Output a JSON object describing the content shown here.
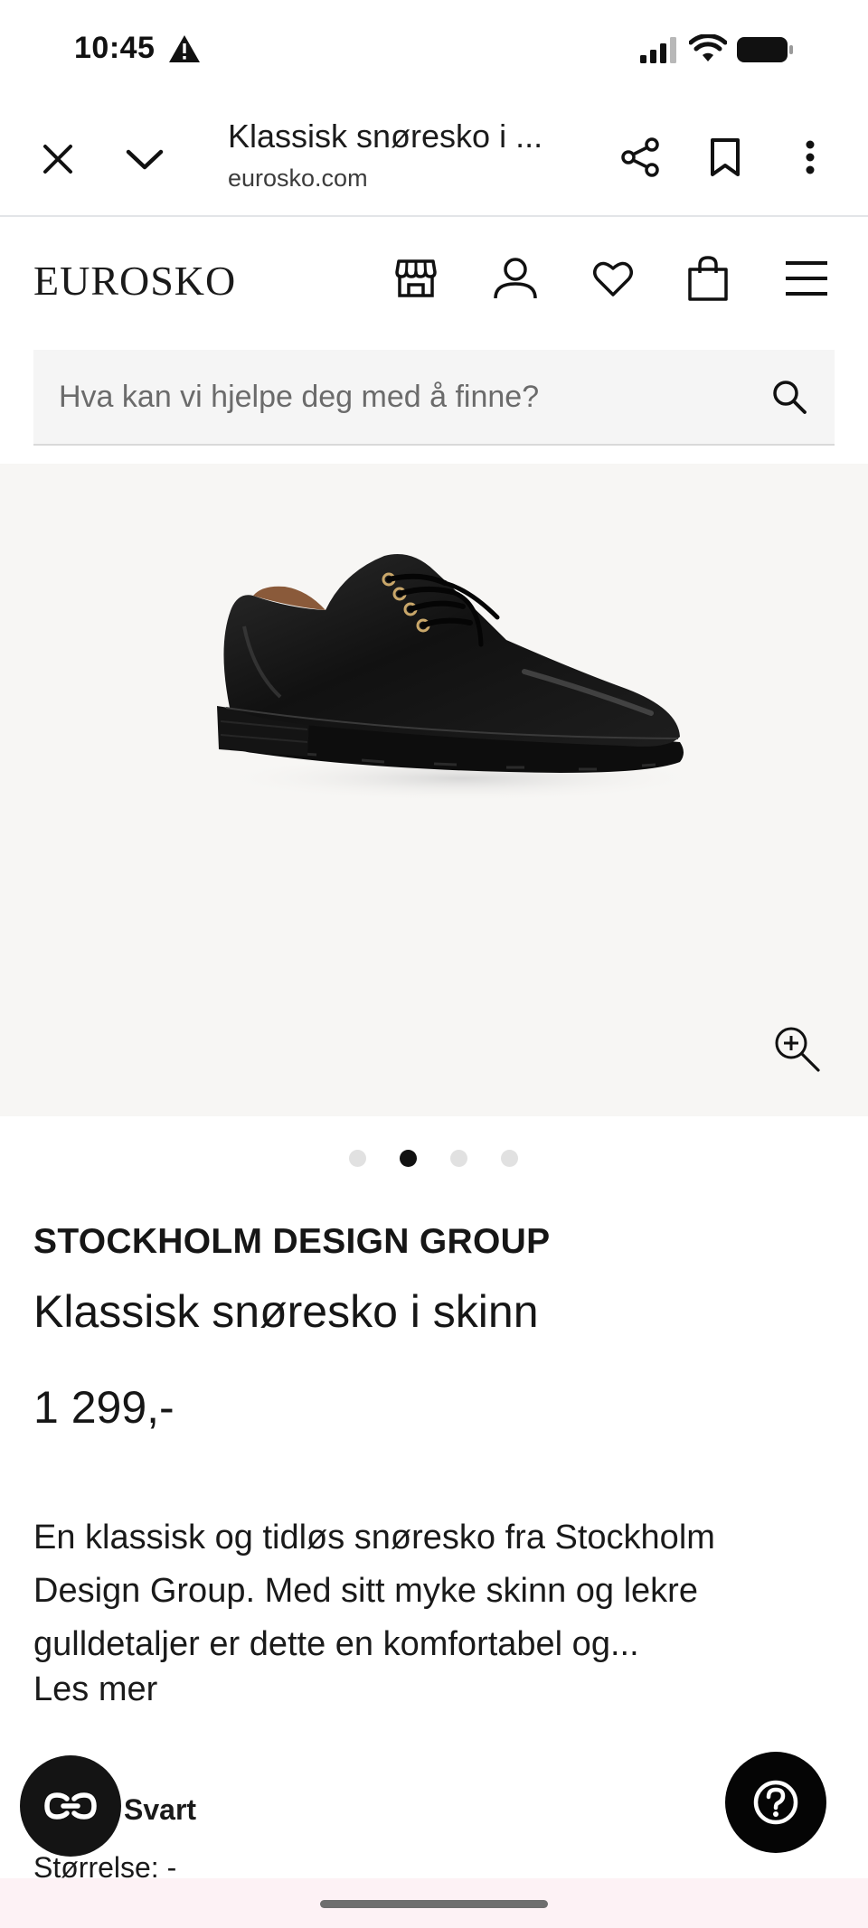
{
  "status_bar": {
    "time": "10:45",
    "icons": [
      "warning-icon",
      "signal-icon",
      "wifi-icon",
      "battery-icon"
    ]
  },
  "browser": {
    "title": "Klassisk snøresko i ...",
    "url": "eurosko.com",
    "icons": [
      "close-icon",
      "chevron-down-icon",
      "share-icon",
      "bookmark-icon",
      "more-vertical-icon"
    ]
  },
  "header": {
    "logo": "EUROSKO",
    "icons": [
      "store-icon",
      "account-icon",
      "heart-icon",
      "bag-icon",
      "menu-icon"
    ]
  },
  "search": {
    "placeholder": "Hva kan vi hjelpe deg med å finne?",
    "value": "",
    "icon": "search-icon"
  },
  "gallery": {
    "image": "black-leather-lace-up-shoe",
    "zoom_icon": "zoom-in-icon",
    "slide_count": 4,
    "active_slide": 2
  },
  "product": {
    "brand": "STOCKHOLM DESIGN GROUP",
    "name": "Klassisk snøresko i skinn",
    "price": "1 299,-",
    "description": "En klassisk og tidløs snøresko fra Stockholm Design Group. Med sitt myke skinn og lekre gulldetaljer er dette en komfortabel og...",
    "read_more": "Les mer",
    "color": "Svart",
    "size_label": "Størrelse: -"
  },
  "floating": {
    "chat_icon": "chat-loop-icon",
    "help_icon": "help-icon"
  },
  "colors": {
    "search_bg": "#f5f5f5",
    "gallery_bg": "#f7f6f4",
    "fab_bg": "#141414",
    "bottom_strip": "#fdf2f5"
  }
}
